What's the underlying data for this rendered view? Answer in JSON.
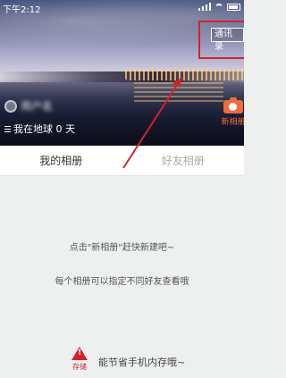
{
  "status_bar": {
    "time": "下午2:12"
  },
  "header": {
    "contacts_label": "通讯录",
    "profile_name": "用户名",
    "profile_days": "我在地球 0 天",
    "new_album_label": "新相册"
  },
  "tabs": [
    {
      "label": "我的相册",
      "active": true
    },
    {
      "label": "好友相册",
      "active": false
    }
  ],
  "content": {
    "hint1": "点击\"新相册\"赶快新建吧~",
    "hint2": "每个相册可以指定不同好友查看哦",
    "storage_badge": "存储",
    "storage_text": "能节省手机内存哦~"
  },
  "colors": {
    "accent": "#f26b3a",
    "highlight": "#d2232a",
    "background": "#eef0f0"
  }
}
